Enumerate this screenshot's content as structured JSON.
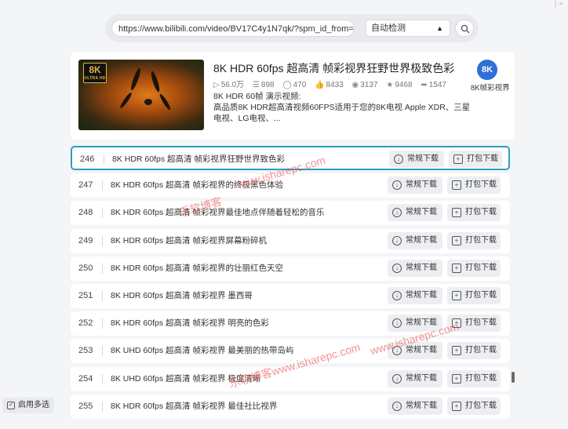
{
  "topbar": {
    "corner_text": "| ×"
  },
  "search": {
    "url_value": "https://www.bilibili.com/video/BV17C4y1N7qk/?spm_id_from=333",
    "mode_value": "自动检测",
    "search_icon": "search-icon",
    "dropdown_icon": "triangle-up-icon"
  },
  "video": {
    "thumb_badge": "8K",
    "thumb_badge_sub": "ULTRA HD",
    "title": "8K HDR 60fps 超高清 帧彩视界狂野世界极致色彩",
    "stats": {
      "plays": "56.0万",
      "danmaku": "898",
      "comments": "470",
      "likes": "8433",
      "coins": "3137",
      "favorites": "9468",
      "shares": "1547"
    },
    "desc_line1": "8K HDR 60帧 演示视频:",
    "desc_line2": "高品质8K HDR超高清视频60FPS适用于您的8K电视 Apple XDR、三星电视、LG电视、...",
    "channel_logo": "8K",
    "channel_name": "8K帧彩视界"
  },
  "list": {
    "normal_label": "常规下载",
    "pack_label": "打包下载",
    "rows": [
      {
        "num": "246",
        "title": "8K HDR 60fps 超高清 帧彩视界狂野世界致色彩"
      },
      {
        "num": "247",
        "title": "8K HDR 60fps 超高清 帧彩视界的终极黑色体验"
      },
      {
        "num": "248",
        "title": "8K HDR 60fps 超高清 帧彩视界最佳地点伴随着轻松的音乐"
      },
      {
        "num": "249",
        "title": "8K HDR 60fps 超高清 帧彩视界屏幕粉碎机"
      },
      {
        "num": "250",
        "title": "8K HDR 60fps 超高清 帧彩视界的壮丽红色天空"
      },
      {
        "num": "251",
        "title": "8K HDR 60fps 超高清 帧彩视界 墨西哥"
      },
      {
        "num": "252",
        "title": "8K HDR 60fps 超高清 帧彩视界 明亮的色彩"
      },
      {
        "num": "253",
        "title": "8K UHD 60fps 超高清 帧彩视界 最美丽的热带岛屿"
      },
      {
        "num": "254",
        "title": "8K UHD 60fps 超高清 帧彩视界 极度清晰"
      },
      {
        "num": "255",
        "title": "8K HDR 60fps 超高清 帧彩视界 最佳社比视界"
      }
    ]
  },
  "watermark": {
    "wm1": "www.isharepc.com",
    "wm2": "乐软博客",
    "wm3": "www.isharepc.com",
    "wm4": "乐软博客www.isharepc.com"
  },
  "footer": {
    "multi_select": "启用多选"
  },
  "colors": {
    "accent": "#2a9fc0",
    "watermark": "#eb5050",
    "channel_logo": "#2f6fd6"
  }
}
